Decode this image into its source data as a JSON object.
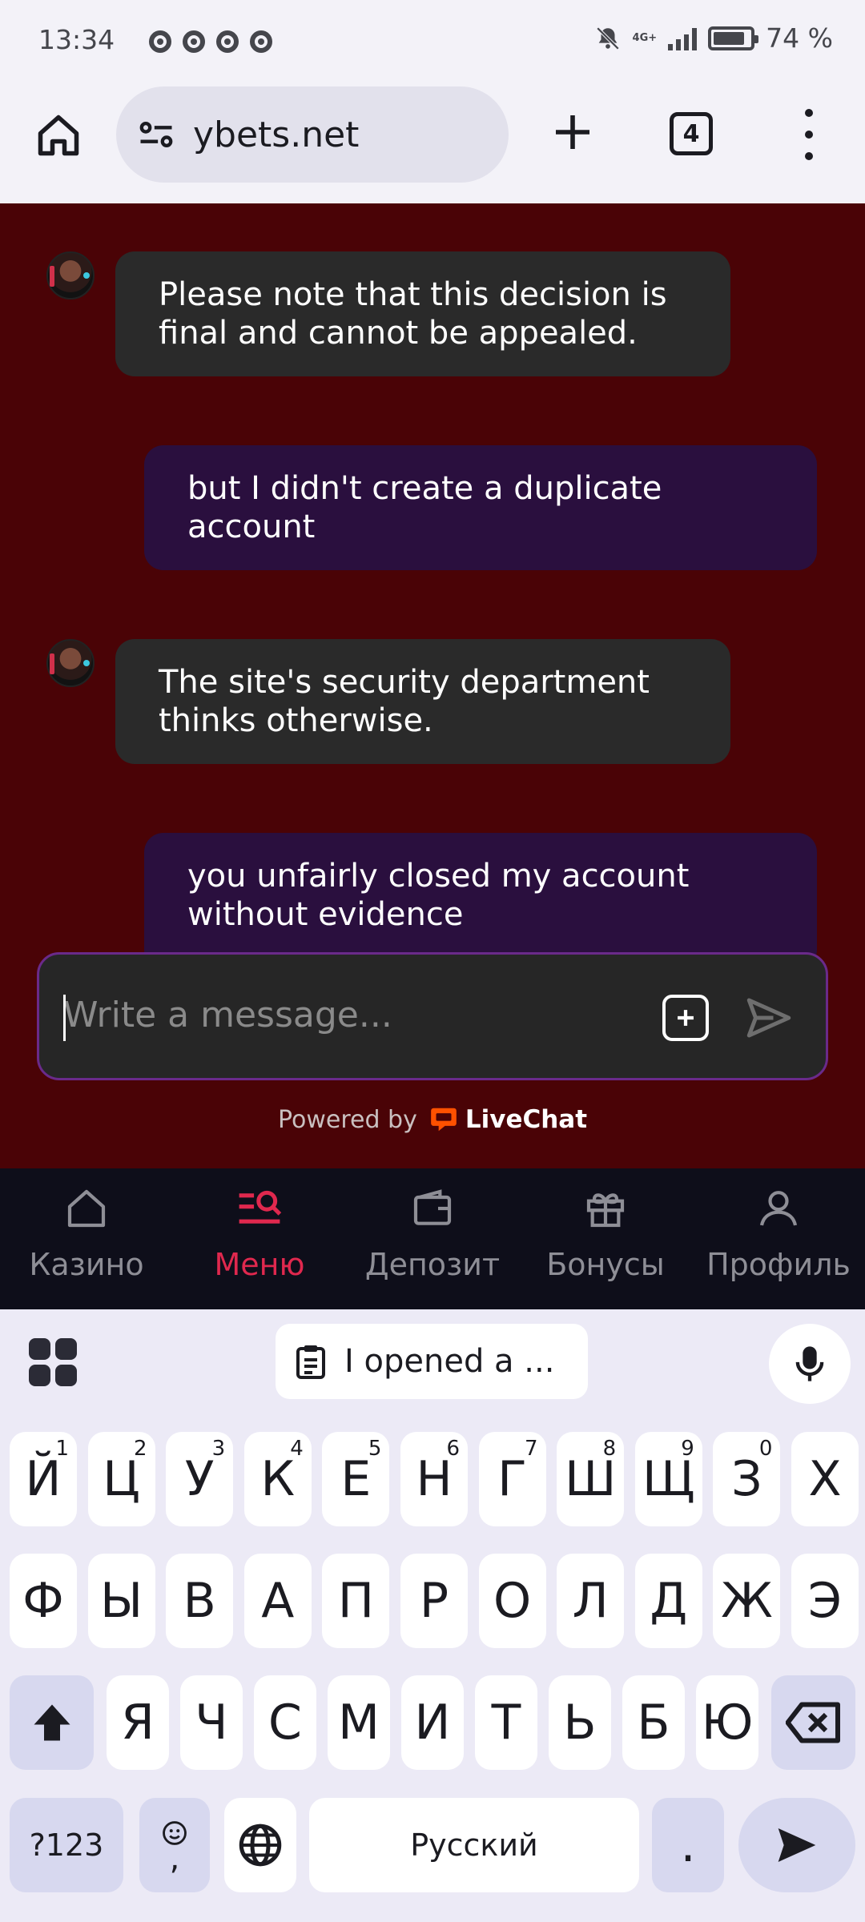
{
  "status_bar": {
    "time": "13:34",
    "battery_text": "74 %",
    "network": "4G+"
  },
  "browser": {
    "url": "ybets.net",
    "tab_count": "4"
  },
  "chat": {
    "messages": [
      {
        "from": "agent",
        "text": "Please note that this decision is final and cannot be appealed."
      },
      {
        "from": "user",
        "text": "but I didn't create a duplicate account"
      },
      {
        "from": "agent",
        "text": "The site's security department thinks otherwise."
      },
      {
        "from": "user",
        "text": "you unfairly closed my account without evidence"
      }
    ],
    "input_placeholder": "Write a message...",
    "powered_by": "Powered by",
    "brand": "LiveChat"
  },
  "bottom_nav": {
    "items": [
      {
        "label": "Казино",
        "icon": "home-icon",
        "active": false
      },
      {
        "label": "Меню",
        "icon": "menu-search-icon",
        "active": true
      },
      {
        "label": "Депозит",
        "icon": "wallet-icon",
        "active": false
      },
      {
        "label": "Бонусы",
        "icon": "gift-icon",
        "active": false
      },
      {
        "label": "Профиль",
        "icon": "profile-icon",
        "active": false
      }
    ]
  },
  "keyboard": {
    "suggestion": "I opened a ...",
    "row1": [
      "Й",
      "Ц",
      "У",
      "К",
      "Е",
      "Н",
      "Г",
      "Ш",
      "Щ",
      "З",
      "Х"
    ],
    "row1_hints": [
      "1",
      "2",
      "3",
      "4",
      "5",
      "6",
      "7",
      "8",
      "9",
      "0",
      ""
    ],
    "row2": [
      "Ф",
      "Ы",
      "В",
      "А",
      "П",
      "Р",
      "О",
      "Л",
      "Д",
      "Ж",
      "Э"
    ],
    "row3": [
      "Я",
      "Ч",
      "С",
      "М",
      "И",
      "Т",
      "Ь",
      "Б",
      "Ю"
    ],
    "num_key": "?123",
    "emoji_comma": ",",
    "space": "Русский",
    "period": "."
  },
  "colors": {
    "chat_bg": "#4a0306",
    "agent_bubble": "#2a2a2a",
    "user_bubble": "#2a0f3e",
    "nav_active": "#e0284e",
    "livechat_orange": "#ff5100"
  }
}
